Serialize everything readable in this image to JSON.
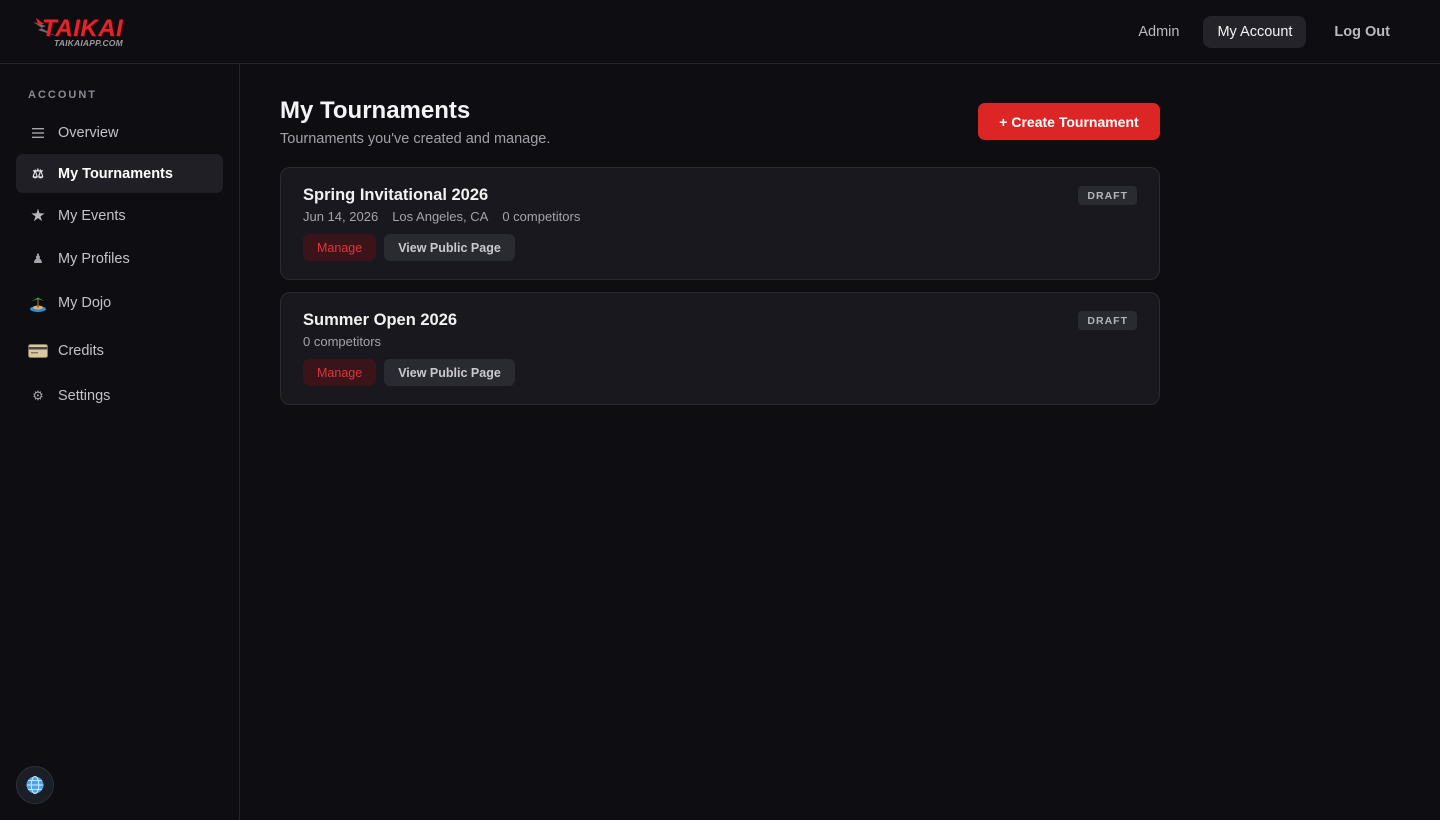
{
  "brand": {
    "logo_word": "TAIKAI",
    "logo_sub": "TAIKAIAPP.COM",
    "accent": "#dc2626"
  },
  "header": {
    "nav": [
      {
        "label": "Admin"
      },
      {
        "label": "My Account",
        "active": true
      },
      {
        "label": "Log Out"
      }
    ]
  },
  "sidebar": {
    "heading": "ACCOUNT",
    "items": [
      {
        "label": "Overview",
        "icon": "list-icon"
      },
      {
        "label": "My Tournaments",
        "icon": "scales-icon",
        "active": true
      },
      {
        "label": "My Events",
        "icon": "star-icon"
      },
      {
        "label": "My Profiles",
        "icon": "person-icon"
      },
      {
        "label": "My Dojo",
        "icon": "island-icon"
      },
      {
        "label": "Credits",
        "icon": "card-icon"
      },
      {
        "label": "Settings",
        "icon": "gear-icon"
      }
    ],
    "language_icon": "globe-icon"
  },
  "main": {
    "title": "My Tournaments",
    "subtitle": "Tournaments you've created and manage.",
    "create_label": "+ Create Tournament",
    "tournaments": [
      {
        "name": "Spring Invitational 2026",
        "date": "Jun 14, 2026",
        "location": "Los Angeles, CA",
        "competitors": "0 competitors",
        "status": "DRAFT",
        "manage_label": "Manage",
        "view_label": "View Public Page"
      },
      {
        "name": "Summer Open 2026",
        "competitors": "0 competitors",
        "status": "DRAFT",
        "manage_label": "Manage",
        "view_label": "View Public Page"
      }
    ]
  }
}
